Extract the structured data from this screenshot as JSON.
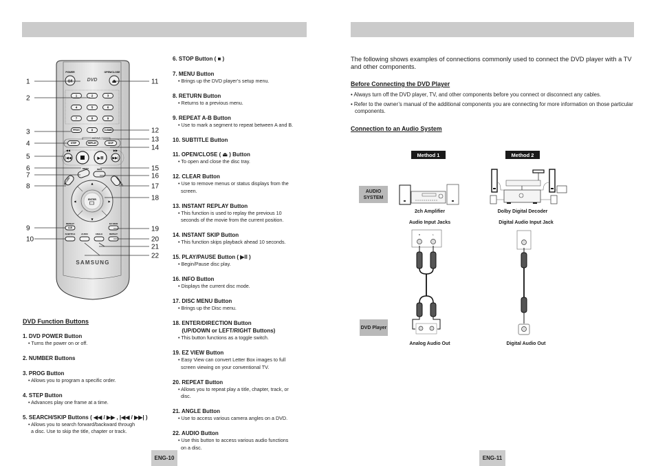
{
  "page_left": {
    "page_number": "ENG-10",
    "remote": {
      "brand": "SAMSUNG",
      "logo": "DVD",
      "button_labels": {
        "power": "POWER",
        "open_close": "OPEN/CLOSE",
        "digits": [
          "1",
          "2",
          "3",
          "4",
          "5",
          "6",
          "7",
          "8",
          "9",
          "0"
        ],
        "prog": "PROG",
        "clear": "CLEAR",
        "instant": "INSTANT",
        "step": "STEP",
        "replay": "REPLAY",
        "skip": "SKIP",
        "menu": "MENU",
        "info": "INFO",
        "return": "RETURN",
        "disc_menu": "DISC MENU",
        "enter": "ENTER",
        "repeat_ab_top": "REPEAT",
        "repeat_ab": "A-B",
        "ez_view": "EZ VIEW",
        "subtitle": "SUBTITLE",
        "audio": "AUDIO",
        "angle": "ANGLE",
        "repeat": "REPEAT"
      },
      "callouts_left": [
        "1",
        "2",
        "3",
        "4",
        "5",
        "6",
        "7",
        "8",
        "9",
        "10"
      ],
      "callouts_right": [
        "11",
        "12",
        "13",
        "14",
        "15",
        "16",
        "17",
        "18",
        "19",
        "20",
        "21",
        "22"
      ]
    },
    "section_title": "DVD Function Buttons",
    "functions_col_a": [
      {
        "head": "1. DVD POWER Button",
        "desc": [
          "Turns the power on or off."
        ]
      },
      {
        "head": "2. NUMBER Buttons",
        "desc": []
      },
      {
        "head": "3. PROG Button",
        "desc": [
          "Allows you to program a specific order."
        ]
      },
      {
        "head": "4. STEP Button",
        "desc": [
          "Advances play one frame at a time."
        ]
      },
      {
        "head": "5. SEARCH/SKIP Buttons ( ◀◀ / ▶▶ , |◀◀ / ▶▶| )",
        "desc": [
          "Allows you to search forward/backward through",
          "a disc. Use to skip the title, chapter or track."
        ]
      }
    ],
    "functions_col_b": [
      {
        "head": "6. STOP Button ( ■ )",
        "desc": []
      },
      {
        "head": "7. MENU Button",
        "desc": [
          "Brings up the DVD player’s setup menu."
        ]
      },
      {
        "head": "8. RETURN Button",
        "desc": [
          "Returns to a previous menu."
        ]
      },
      {
        "head": "9. REPEAT A-B Button",
        "desc": [
          "Use to mark a segment to repeat between A and B."
        ]
      },
      {
        "head": "10. SUBTITLE Button",
        "desc": []
      },
      {
        "head": "11. OPEN/CLOSE ( ⏏ ) Button",
        "desc": [
          "To open and close the disc tray."
        ]
      },
      {
        "head": "12. CLEAR Button",
        "desc": [
          "Use to remove menus or status displays from the",
          "screen."
        ]
      },
      {
        "head": "13. INSTANT REPLAY Button",
        "desc": [
          "This function is used to replay the previous 10",
          "seconds of the movie from the current position."
        ]
      },
      {
        "head": "14. INSTANT SKIP Button",
        "desc": [
          "This function skips playback ahead 10 seconds."
        ]
      },
      {
        "head": "15. PLAY/PAUSE Button ( ▶II )",
        "desc": [
          "Begin/Pause disc play."
        ]
      },
      {
        "head": "16. INFO Button",
        "desc": [
          "Displays the current disc mode."
        ]
      },
      {
        "head": "17. DISC MENU Button",
        "desc": [
          "Brings up the Disc menu."
        ]
      },
      {
        "head": "18. ENTER/DIRECTION Button\n      (UP/DOWN or LEFT/RIGHT Buttons)",
        "desc": [
          "This button functions as a toggle switch."
        ]
      },
      {
        "head": "19. EZ VIEW Button",
        "desc": [
          "Easy View can convert Letter Box images to full",
          "screen viewing on your conventional TV."
        ]
      },
      {
        "head": "20. REPEAT Button",
        "desc": [
          "Allows you to repeat play a title, chapter, track, or",
          "disc."
        ]
      },
      {
        "head": "21. ANGLE Button",
        "desc": [
          "Use to access various camera angles on a DVD."
        ]
      },
      {
        "head": "22. AUDIO Button",
        "desc": [
          "Use this button to access various audio functions",
          "on a disc."
        ]
      }
    ]
  },
  "page_right": {
    "page_number": "ENG-11",
    "intro": "The following shows examples of connections commonly used to connect the DVD player with a TV and other components.",
    "before_title": "Before Connecting the DVD Player",
    "before_bullets": [
      "Always turn off the DVD player, TV, and other components before you connect or disconnect any cables.",
      "Refer to the owner’s manual of the additional components you are connecting for more information on those particular components."
    ],
    "connection_title": "Connection to an Audio System",
    "diagram": {
      "method1": "Method 1",
      "method2": "Method 2",
      "audio_system_label": "AUDIO SYSTEM",
      "dvd_player_label": "DVD Player",
      "amp_label": "2ch Amplifier",
      "amp_jacks_label": "Audio Input Jacks",
      "decoder_label": "Dolby Digital Decoder",
      "decoder_jack_label": "Digital Audio Input Jack",
      "analog_out_label": "Analog Audio Out",
      "digital_out_label": "Digital Audio Out",
      "jack_r": "R",
      "jack_l": "L"
    }
  }
}
